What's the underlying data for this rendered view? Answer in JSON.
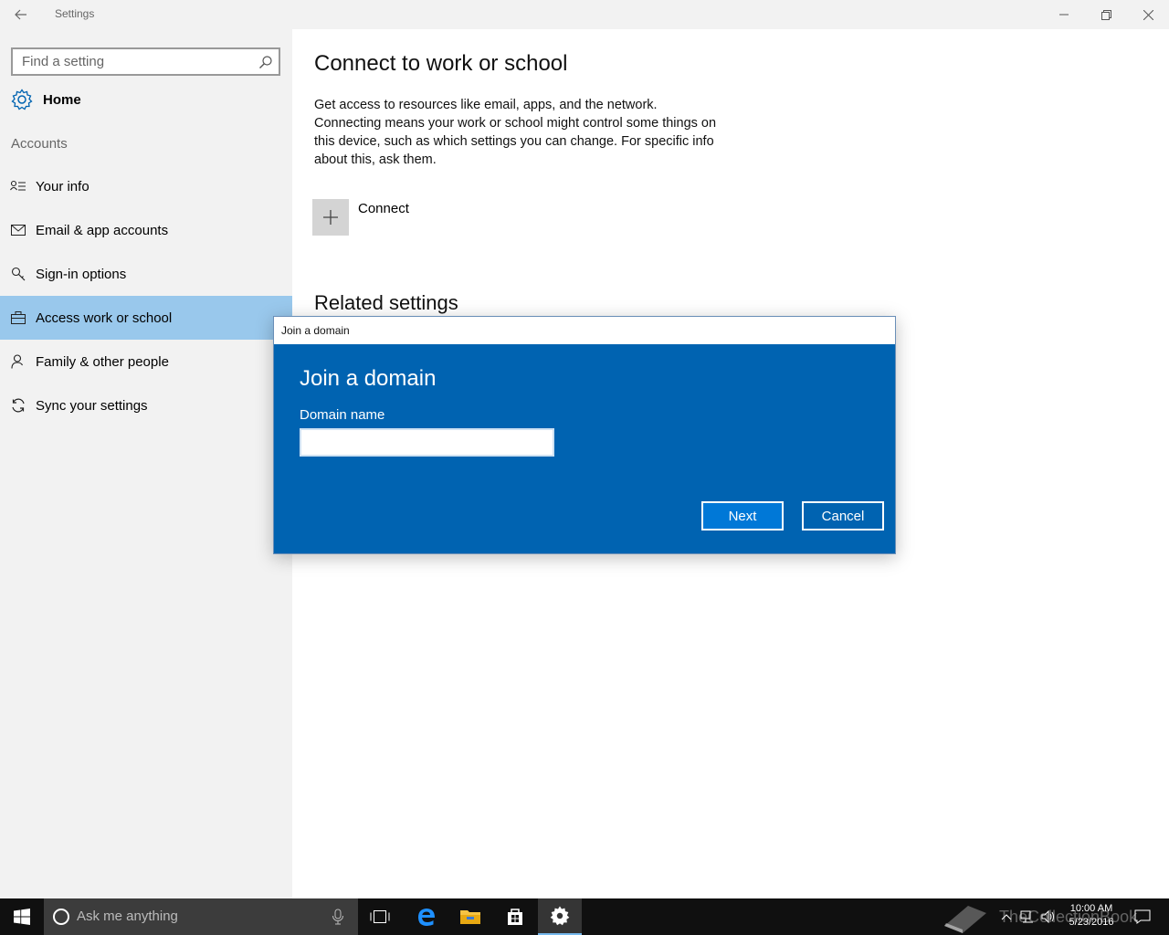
{
  "window": {
    "title": "Settings",
    "back_icon": "back-arrow-icon",
    "controls": [
      "minimize-icon",
      "restore-icon",
      "close-icon"
    ]
  },
  "sidebar": {
    "search_placeholder": "Find a setting",
    "home_label": "Home",
    "section_label": "Accounts",
    "items": [
      {
        "label": "Your info",
        "icon": "contact-card-icon",
        "selected": false
      },
      {
        "label": "Email & app accounts",
        "icon": "mail-icon",
        "selected": false
      },
      {
        "label": "Sign-in options",
        "icon": "key-icon",
        "selected": false
      },
      {
        "label": "Access work or school",
        "icon": "briefcase-icon",
        "selected": true
      },
      {
        "label": "Family & other people",
        "icon": "person-icon",
        "selected": false
      },
      {
        "label": "Sync your settings",
        "icon": "sync-icon",
        "selected": false
      }
    ]
  },
  "main": {
    "title": "Connect to work or school",
    "description": "Get access to resources like email, apps, and the network. Connecting means your work or school might control some things on this device, such as which settings you can change. For specific info about this, ask them.",
    "connect_label": "Connect",
    "related_title": "Related settings"
  },
  "dialog": {
    "window_title": "Join a domain",
    "heading": "Join a domain",
    "field_label": "Domain name",
    "field_value": "",
    "next_label": "Next",
    "cancel_label": "Cancel"
  },
  "taskbar": {
    "search_placeholder": "Ask me anything",
    "time": "10:00 AM",
    "date": "5/23/2016",
    "watermark": "TheCollectionBook"
  },
  "colors": {
    "accent": "#0063b1",
    "selected_nav": "#99c8ec",
    "sidebar_bg": "#f2f2f2"
  }
}
